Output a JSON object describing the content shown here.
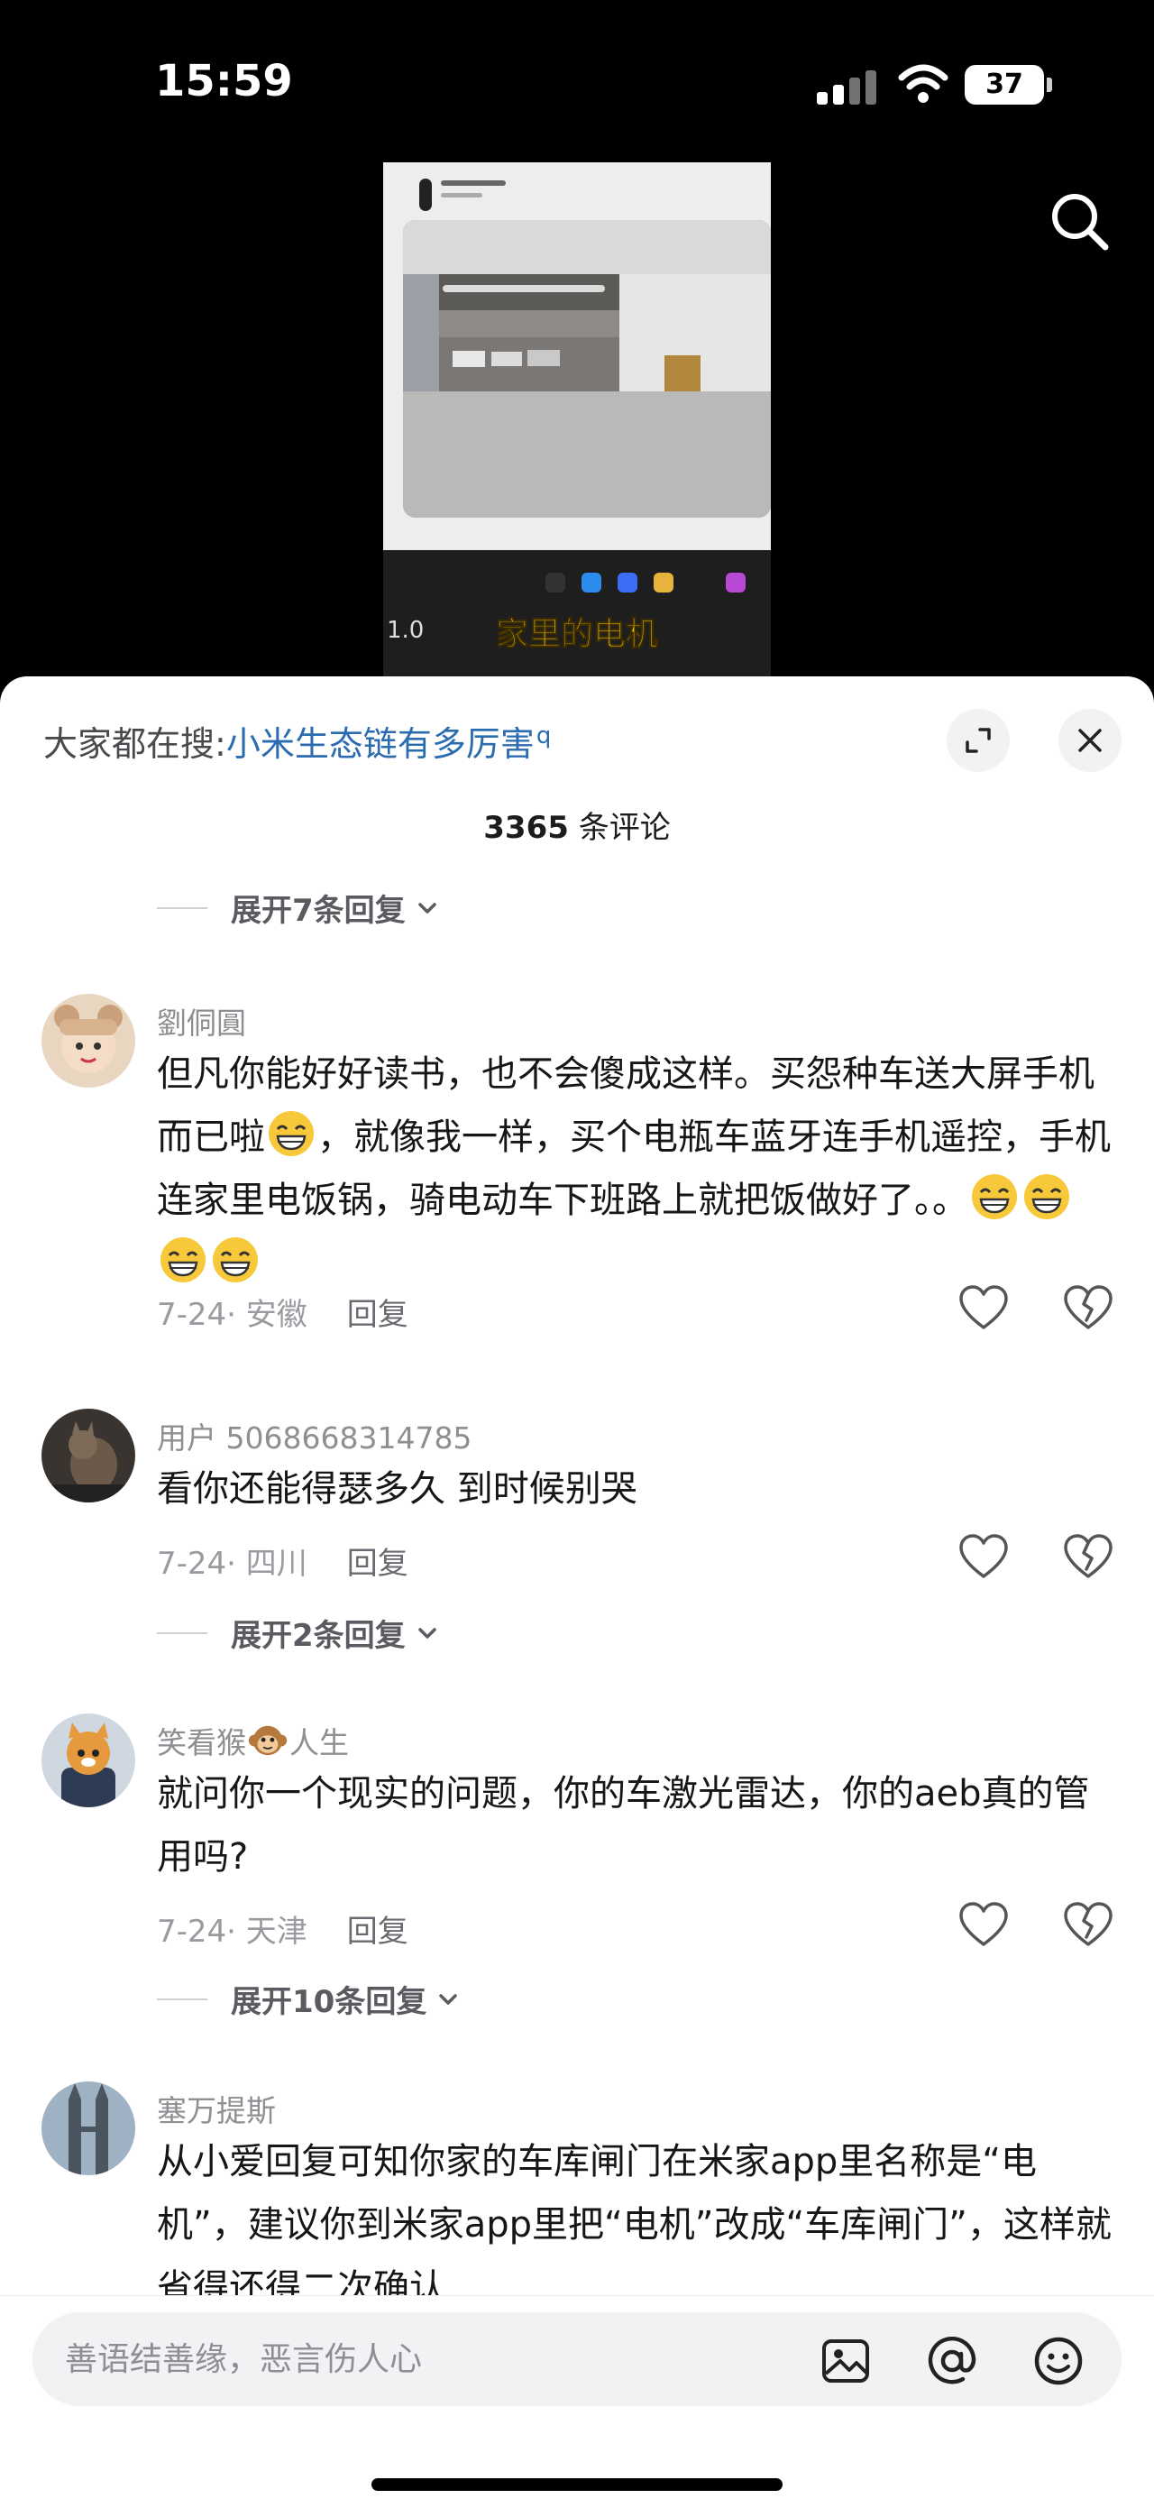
{
  "status_bar": {
    "time": "15:59",
    "battery": "37"
  },
  "video": {
    "caption": "家里的电机",
    "side_label": "1.0"
  },
  "comment_sheet": {
    "hot_search_prefix": "大家都在搜:",
    "hot_search_keyword": "小米生态链有多厉害",
    "comment_count": "3365",
    "comment_count_suffix": " 条评论",
    "top_expand": "展开7条回复",
    "comments": [
      {
        "username": "劉侗圓",
        "text": "但凡你能好好读书，也不会傻成这样。买怨种车送大屏手机而已啦",
        "text_after_emoji": "，就像我一样，买个电瓶车蓝牙连手机遥控，手机连家里电饭锅，骑电动车下班路上就把饭做好了。。",
        "date": "7-24",
        "location": "安徽",
        "reply_label": "回复"
      },
      {
        "username": "用户 5068668314785",
        "text": "看你还能得瑟多久 到时候别哭",
        "date": "7-24",
        "location": "四川",
        "reply_label": "回复",
        "expand": "展开2条回复"
      },
      {
        "username_part1": "笑看猴",
        "username_part2": "人生",
        "text": "就问你一个现实的问题，你的车激光雷达，你的aeb真的管用吗?",
        "date": "7-24",
        "location": "天津",
        "reply_label": "回复",
        "expand": "展开10条回复"
      },
      {
        "username": "塞万提斯",
        "text": "从小爱回复可知你家的车库闸门在米家app里名称是“电机”，建议你到米家app里把“电机”改成“车库闸门”，这样就省得还得二次确认"
      }
    ]
  },
  "input_bar": {
    "placeholder": "善语结善缘，恶言伤人心"
  },
  "icons": {
    "signal": "cellular-signal-icon",
    "wifi": "wifi-icon",
    "search": "search-icon",
    "expand": "expand-icon",
    "close": "close-icon",
    "like": "heart-icon",
    "dislike": "broken-heart-icon",
    "image": "image-icon",
    "mention": "at-icon",
    "emoji": "emoji-icon"
  },
  "colors": {
    "keyword_blue": "#2b6cb0",
    "caption_yellow": "#f5c518",
    "sheet_bg": "#ffffff",
    "page_bg": "#000000"
  }
}
